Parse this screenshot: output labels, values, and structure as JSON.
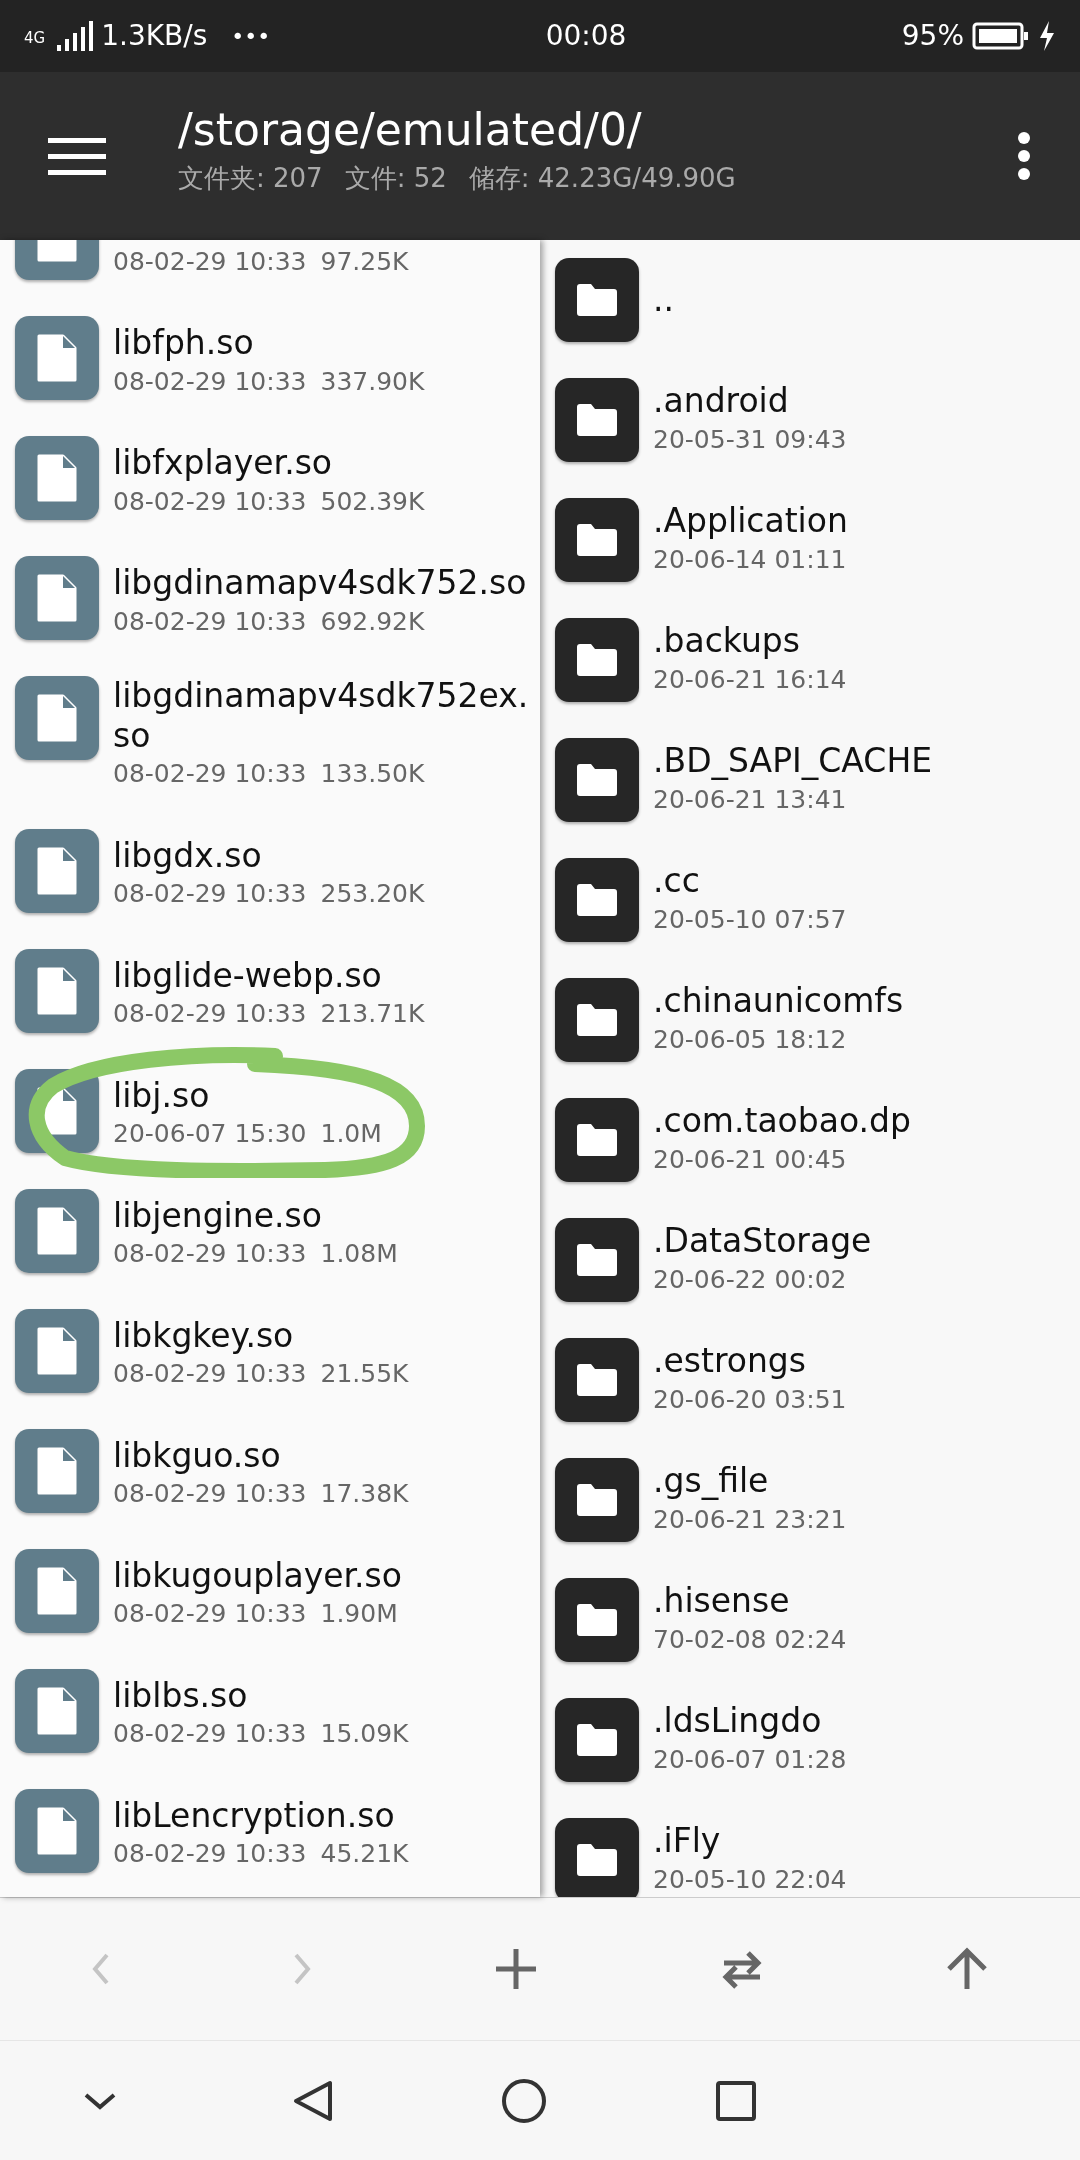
{
  "status_bar": {
    "network": "4G",
    "speed": "1.3KB/s",
    "more": "•••",
    "time": "00:08",
    "battery": "95%",
    "charging": true
  },
  "header": {
    "path": "/storage/emulated/0/",
    "stats": [
      "文件夹: 207",
      "文件: 52",
      "储存: 42.23G/49.90G"
    ]
  },
  "left_pane": {
    "files": [
      {
        "modified": "08-02-29 10:33",
        "size": "97.25K",
        "circled": false
      },
      {
        "name": "libfph.so",
        "modified": "08-02-29 10:33",
        "size": "337.90K",
        "circled": false
      },
      {
        "name": "libfxplayer.so",
        "modified": "08-02-29 10:33",
        "size": "502.39K",
        "circled": false
      },
      {
        "name": "libgdinamapv4sdk752.so",
        "modified": "08-02-29 10:33",
        "size": "692.92K",
        "circled": false
      },
      {
        "name": "libgdinamapv4sdk752ex.so",
        "modified": "08-02-29 10:33",
        "size": "133.50K",
        "circled": false
      },
      {
        "name": "libgdx.so",
        "modified": "08-02-29 10:33",
        "size": "253.20K",
        "circled": false
      },
      {
        "name": "libglide-webp.so",
        "modified": "08-02-29 10:33",
        "size": "213.71K",
        "circled": false
      },
      {
        "name": "libj.so",
        "modified": "20-06-07 15:30",
        "size": "1.0M",
        "circled": true
      },
      {
        "name": "libjengine.so",
        "modified": "08-02-29 10:33",
        "size": "1.08M",
        "circled": false
      },
      {
        "name": "libkgkey.so",
        "modified": "08-02-29 10:33",
        "size": "21.55K",
        "circled": false
      },
      {
        "name": "libkguo.so",
        "modified": "08-02-29 10:33",
        "size": "17.38K",
        "circled": false
      },
      {
        "name": "libkugouplayer.so",
        "modified": "08-02-29 10:33",
        "size": "1.90M",
        "circled": false
      },
      {
        "name": "liblbs.so",
        "modified": "08-02-29 10:33",
        "size": "15.09K",
        "circled": false
      },
      {
        "name": "libLencryption.so",
        "modified": "08-02-29 10:33",
        "size": "45.21K",
        "circled": false
      }
    ]
  },
  "right_pane": {
    "folders": [
      {
        "name": ".."
      },
      {
        "name": ".android",
        "modified": "20-05-31 09:43"
      },
      {
        "name": ".Application",
        "modified": "20-06-14 01:11"
      },
      {
        "name": ".backups",
        "modified": "20-06-21 16:14"
      },
      {
        "name": ".BD_SAPI_CACHE",
        "modified": "20-06-21 13:41"
      },
      {
        "name": ".cc",
        "modified": "20-05-10 07:57"
      },
      {
        "name": ".chinaunicomfs",
        "modified": "20-06-05 18:12"
      },
      {
        "name": ".com.taobao.dp",
        "modified": "20-06-21 00:45"
      },
      {
        "name": ".DataStorage",
        "modified": "20-06-22 00:02"
      },
      {
        "name": ".estrongs",
        "modified": "20-06-20 03:51"
      },
      {
        "name": ".gs_file",
        "modified": "20-06-21 23:21"
      },
      {
        "name": ".hisense",
        "modified": "70-02-08 02:24"
      },
      {
        "name": ".ldsLingdo",
        "modified": "20-06-07 01:28"
      },
      {
        "name": ".iFly",
        "modified": "20-05-10 22:04"
      }
    ]
  },
  "toolbar": [
    {
      "kind": "back",
      "disabled": true
    },
    {
      "kind": "forward",
      "disabled": true
    },
    {
      "kind": "add",
      "disabled": false
    },
    {
      "kind": "swap",
      "disabled": false
    },
    {
      "kind": "up",
      "disabled": false
    }
  ],
  "nav_bar": [
    {
      "kind": "hide"
    },
    {
      "kind": "back"
    },
    {
      "kind": "home"
    },
    {
      "kind": "recents"
    }
  ]
}
